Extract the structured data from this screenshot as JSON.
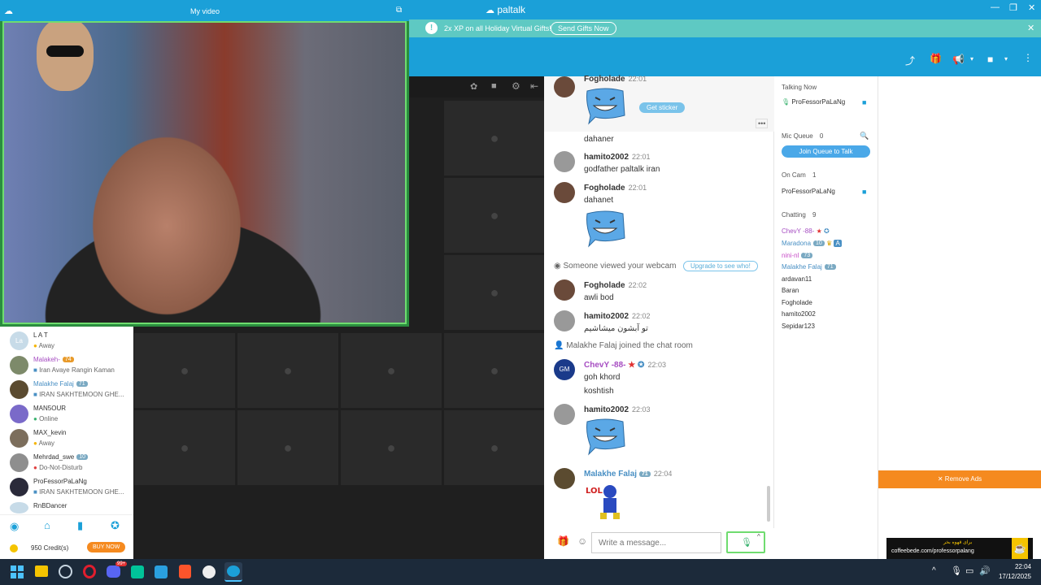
{
  "window": {
    "app_name": "paltalk",
    "controls": [
      "—",
      "❐",
      "✕"
    ]
  },
  "promo": {
    "text": "2x XP on all Holiday Virtual Gifts!",
    "button": "Send Gifts Now"
  },
  "myvideo": {
    "title": "My video"
  },
  "members": [
    {
      "name": "L A T",
      "status": "Away",
      "color": "#333"
    },
    {
      "name": "Malakeh-",
      "badge": "74",
      "status": "Iran Avaye Rangin Kaman",
      "color": "#a64dc2"
    },
    {
      "name": "Malakhe Falaj",
      "badge": "71",
      "status": "IRAN SAKHTEMOON GHE...",
      "color": "#4a90c4"
    },
    {
      "name": "MAN5OUR",
      "status": "Online",
      "color": "#333"
    },
    {
      "name": "MAX_kevin",
      "status": "Away",
      "color": "#333"
    },
    {
      "name": "Mehrdad_swe",
      "badge": "10",
      "status": "Do-Not-Disturb",
      "color": "#333"
    },
    {
      "name": "ProFessorPaLaNg",
      "status": "IRAN SAKHTEMOON GHE...",
      "color": "#333"
    },
    {
      "name": "RnBDancer",
      "status": "",
      "color": "#333"
    }
  ],
  "credits": {
    "text": "950 Credit(s)",
    "buy": "BUY NOW"
  },
  "chat": {
    "top": {
      "name": "Fogholade",
      "time": "22:01",
      "sticker_button": "Get sticker"
    },
    "messages": [
      {
        "text": "dahaner"
      },
      {
        "name": "hamito2002",
        "time": "22:01",
        "text": "godfather paltalk iran"
      },
      {
        "name": "Fogholade",
        "time": "22:01",
        "text": "dahanet"
      },
      {
        "system": "Someone viewed your webcam",
        "button": "Upgrade to see who!"
      },
      {
        "name": "Fogholade",
        "time": "22:02",
        "text": "awli bod"
      },
      {
        "name": "hamito2002",
        "time": "22:02",
        "text": "تو آبشون میشاشیم"
      },
      {
        "system": "Malakhe Falaj joined the chat room"
      },
      {
        "name": "ChevY -88-",
        "time": "22:03",
        "text": "goh khord",
        "text2": "koshtish"
      },
      {
        "name": "hamito2002",
        "time": "22:03"
      },
      {
        "name": "Malakhe Falaj",
        "badge": "71",
        "time": "22:04"
      }
    ],
    "placeholder": "Write a message..."
  },
  "right": {
    "talking_now": "Talking Now",
    "talker": "ProFessorPaLaNg",
    "mic_queue": "Mic Queue",
    "mic_count": "0",
    "join_queue": "Join Queue to Talk",
    "on_cam": "On Cam",
    "on_cam_count": "1",
    "cam_user": "ProFessorPaLaNg",
    "chatting": "Chatting",
    "chatting_count": "9",
    "users": [
      {
        "name": "ChevY -88-",
        "color": "#a64dc2"
      },
      {
        "name": "Maradona",
        "badge": "10",
        "color": "#4a90c4"
      },
      {
        "name": "nini-nl",
        "badge": "73",
        "color": "#c74cc7"
      },
      {
        "name": "Malakhe Falaj",
        "badge": "71",
        "color": "#4a90c4"
      },
      {
        "name": "ardavan11",
        "color": "#333"
      },
      {
        "name": "Baran",
        "color": "#333"
      },
      {
        "name": "Fogholade",
        "color": "#333"
      },
      {
        "name": "hamito2002",
        "color": "#333"
      },
      {
        "name": "Sepidar123",
        "color": "#333"
      }
    ]
  },
  "ads": {
    "remove": "✕ Remove Ads",
    "banner_line1": "برای قهوه بخر",
    "banner_line2": "coffeebede.com/professorpalang"
  },
  "taskbar": {
    "time": "22:04",
    "date": "17/12/2025",
    "notif": "99+"
  },
  "colors": {
    "brand": "#1ba0d8",
    "promo": "#5ec9c3",
    "ad_orange": "#f58a1f",
    "green": "#6fdc6f"
  }
}
